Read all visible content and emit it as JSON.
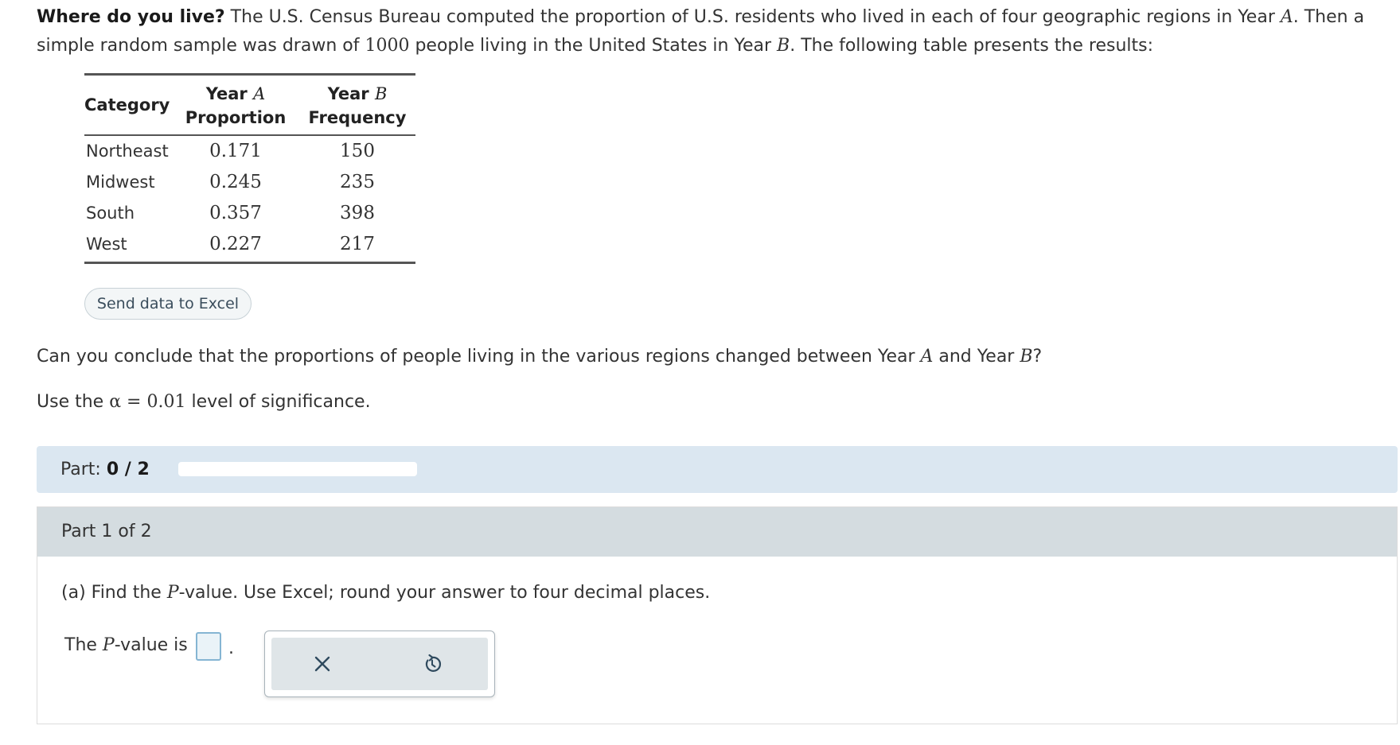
{
  "problem": {
    "title": "Where do you live?",
    "intro_a": " The U.S. Census Bureau computed the proportion of U.S. residents who lived in each of four geographic regions in Year ",
    "year_a_var": "A",
    "intro_b": ". Then a simple random sample was drawn of ",
    "sample_size": "1000",
    "intro_c": " people living in the United States in Year ",
    "year_b_var": "B",
    "intro_d": ". The following table presents the results:"
  },
  "table": {
    "headers": {
      "category": "Category",
      "col2_line1": "Year",
      "col2_var": "A",
      "col2_line2": "Proportion",
      "col3_line1": "Year",
      "col3_var": "B",
      "col3_line2": "Frequency"
    },
    "rows": [
      {
        "category": "Northeast",
        "proportion": "0.171",
        "frequency": "150"
      },
      {
        "category": "Midwest",
        "proportion": "0.245",
        "frequency": "235"
      },
      {
        "category": "South",
        "proportion": "0.357",
        "frequency": "398"
      },
      {
        "category": "West",
        "proportion": "0.227",
        "frequency": "217"
      }
    ]
  },
  "excel_button_label": "Send data to Excel",
  "question": {
    "text_a": "Can you conclude that the proportions of people living in the various regions changed between Year ",
    "var_a": "A",
    "text_b": " and Year ",
    "var_b": "B",
    "text_c": "?"
  },
  "significance": {
    "text_a": "Use the ",
    "alpha": "α",
    "equals": " = ",
    "value": "0.01",
    "text_b": " level of significance."
  },
  "progress": {
    "label": "Part: ",
    "value": "0 / 2",
    "fraction": 0.0
  },
  "part": {
    "header": "Part 1 of 2",
    "question_a": "(a) Find the ",
    "p_var": "P",
    "question_b": "-value. Use Excel; round your answer to four decimal places.",
    "answer_prefix": "The ",
    "answer_var": "P",
    "answer_suffix": "-value is",
    "answer_value": "",
    "period": "."
  },
  "tools": {
    "clear_icon": "close-icon",
    "undo_icon": "undo-icon"
  },
  "colors": {
    "progress_bg": "#dbe7f1",
    "part_header_bg": "#d4dce0",
    "answer_border": "#85b5d3",
    "icon_color": "#2f4a5e"
  }
}
